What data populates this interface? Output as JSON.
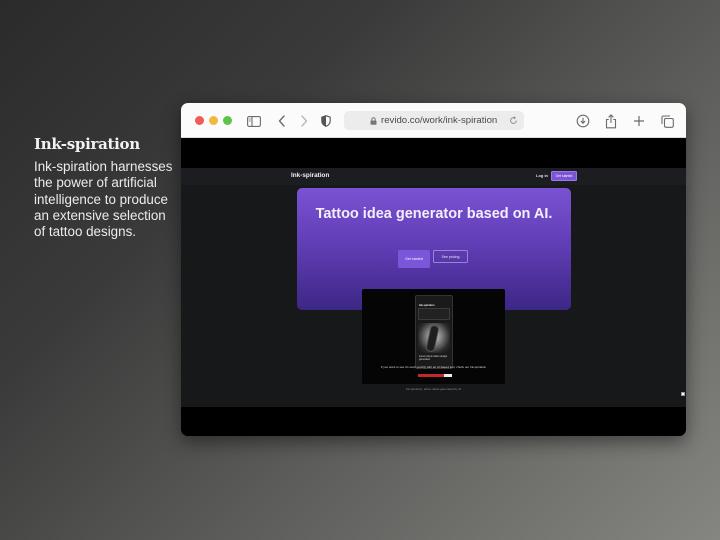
{
  "description": {
    "title": "Ink-spiration",
    "body": "Ink-spiration harnesses the power of artificial intelligence to produce an extensive selection of tattoo designs."
  },
  "browser": {
    "url": "revido.co/work/ink-spiration",
    "icons": [
      "sidebar-icon",
      "back-icon",
      "forward-icon",
      "shield-icon",
      "lock-icon",
      "reload-icon",
      "download-icon",
      "share-icon",
      "new-tab-icon",
      "tabs-overview-icon"
    ]
  },
  "site": {
    "nav": {
      "logo": "Ink-spiration",
      "login_label": "Log in",
      "signup_label": "Get started"
    },
    "hero": {
      "title": "Tattoo idea generator based on AI.",
      "primary_button": "Get started",
      "secondary_button": "See pricing"
    },
    "video": {
      "phone_brand": "Ink-spiration",
      "phone_caption": "Lorem ipsum tattoo design generated",
      "subtitle": "If you want to see it's work quickly with an AI-based tool, check out Ink-spiration",
      "progress": 0.76
    },
    "footnote": "Ink-spiration, tattoo ideas generated by AI"
  },
  "colors": {
    "accent": "#7a53d6",
    "hero_top": "#7a52d4",
    "hero_bottom": "#3c2785",
    "site_bg": "#17181a"
  }
}
